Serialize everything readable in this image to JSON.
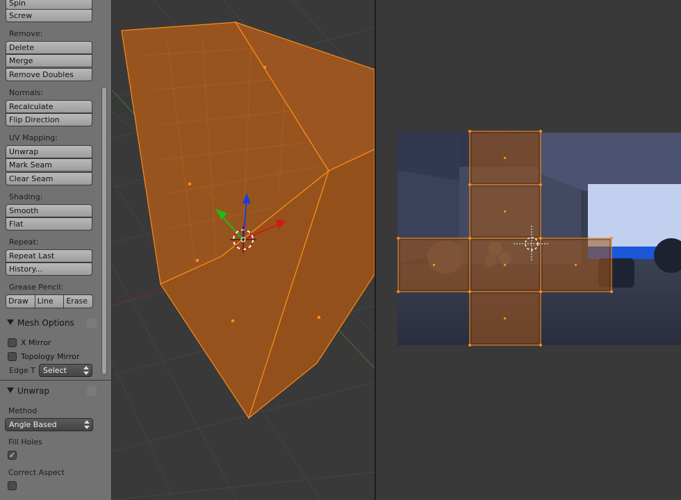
{
  "toolshelf": {
    "top_buttons": [
      "Spin",
      "Screw"
    ],
    "remove": {
      "label": "Remove:",
      "buttons": [
        "Delete",
        "Merge",
        "Remove Doubles"
      ]
    },
    "normals": {
      "label": "Normals:",
      "buttons": [
        "Recalculate",
        "Flip Direction"
      ]
    },
    "uv_mapping": {
      "label": "UV Mapping:",
      "buttons": [
        "Unwrap",
        "Mark Seam",
        "Clear Seam"
      ]
    },
    "shading": {
      "label": "Shading:",
      "buttons": [
        "Smooth",
        "Flat"
      ]
    },
    "repeat": {
      "label": "Repeat:",
      "buttons": [
        "Repeat Last",
        "History..."
      ]
    },
    "grease_pencil": {
      "label": "Grease Pencil:",
      "buttons": [
        "Draw",
        "Line",
        "Erase"
      ]
    }
  },
  "mesh_options": {
    "title": "Mesh Options",
    "x_mirror": {
      "label": "X Mirror",
      "checked": false
    },
    "topology_mirror": {
      "label": "Topology Mirror",
      "checked": false
    },
    "edge_label": "Edge T",
    "edge_value": "Select"
  },
  "unwrap": {
    "title": "Unwrap",
    "method_label": "Method",
    "method_value": "Angle Based",
    "fill_holes": {
      "label": "Fill Holes",
      "checked": true,
      "mark": "✓"
    },
    "correct_aspect": {
      "label": "Correct Aspect",
      "checked": false
    }
  },
  "colors": {
    "panel_bg": "#727272",
    "viewport_bg": "#393939",
    "selection_orange": "#ff8c1a",
    "face_fill": "#a5581a",
    "axis_x": "#d41818",
    "axis_y": "#18c018",
    "axis_z": "#1a3dd8"
  },
  "icons": {
    "cursor_3d": "3d-cursor-icon",
    "cursor_2d": "2d-cursor-icon",
    "panel_collapse": "triangle-down-icon"
  }
}
